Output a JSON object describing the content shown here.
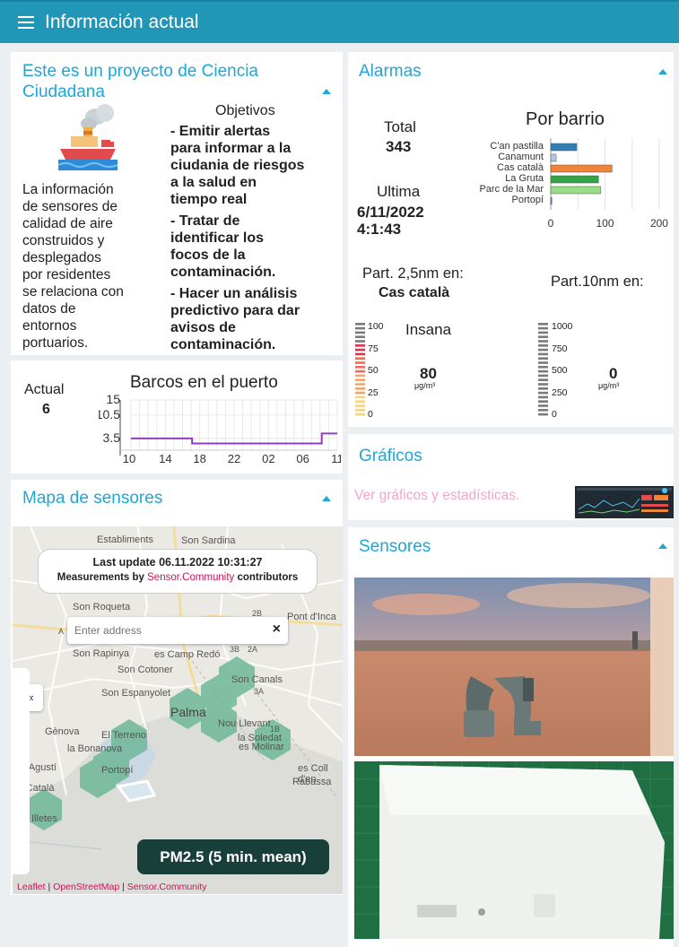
{
  "header": {
    "title": "Información actual",
    "menu_icon": "menu-icon"
  },
  "project": {
    "title": "Este es un proyecto de Ciencia Ciudadana",
    "logo_icon": "ship-smoke-icon",
    "description": [
      "La información",
      "de sensores de",
      "calidad de aire",
      "construidos y",
      "desplegados",
      "por residentes",
      "se relaciona con",
      "datos de",
      "entornos",
      "portuarios."
    ],
    "objectives_title": "Objetivos",
    "objectives": [
      [
        "- Emitir alertas",
        "para informar a la",
        "ciudania de riesgos",
        "a la salud en",
        "tiempo real"
      ],
      [
        "- Tratar de",
        "identificar los",
        "focos de la",
        "contaminación."
      ],
      [
        "- Hacer un análisis",
        "predictivo para dar",
        "avisos de",
        "contaminación."
      ]
    ]
  },
  "ships": {
    "current_label": "Actual",
    "current_value": "6",
    "chart_title": "Barcos en el puerto"
  },
  "map_card": {
    "title": "Mapa de sensores",
    "last_update": "Last update 06.11.2022 10:31:27",
    "measurements_prefix": "Measurements by ",
    "measurements_link": "Sensor.Community",
    "measurements_suffix": " contributors",
    "search_placeholder": "Enter address",
    "clear_label": "×",
    "sidebar_toggle": "«",
    "pm_badge": "PM2.5 (5 min. mean)",
    "attr_leaflet": "Leaflet",
    "attr_sep1": " | ",
    "attr_osm": "OpenStreetMap",
    "attr_sep2": " | ",
    "attr_sc": "Sensor.Community",
    "places": [
      "Establiments",
      "Son Sardina",
      "Son Roqueta",
      "Pont d'Inca",
      "Son Rapinya",
      "es Camp Redó",
      "Son Cotoner",
      "Son Canals",
      "Son Espanyolet",
      "Palma",
      "Nou Llevant",
      "Gènova",
      "El Terreno",
      "la Soledat",
      "la Bonanova",
      "es Molinar",
      "ant Agustí",
      "Portopí",
      "es Coll d'en",
      "Rabassa",
      "es Català",
      "Illetes",
      "3B",
      "2B",
      "2A",
      "3A",
      "1B",
      "A"
    ]
  },
  "alarms": {
    "title": "Alarmas",
    "total_label": "Total",
    "total_value": "343",
    "last_label": "Ultima",
    "last_date": "6/11/2022",
    "last_time": "4:1:43",
    "by_barrio_title": "Por barrio",
    "pm25_label": "Part. 2,5nm en:",
    "pm25_place": "Cas català",
    "pm10_label": "Part.10nm en:",
    "gauge1_status": "Insana",
    "gauge1_value": "80",
    "gauge1_unit": "μg/m³",
    "gauge1_ticks": [
      "100",
      "75",
      "50",
      "25",
      "0"
    ],
    "gauge2_value": "0",
    "gauge2_unit": "μg/m³",
    "gauge2_ticks": [
      "1000",
      "750",
      "500",
      "250",
      "0"
    ]
  },
  "graphs": {
    "title": "Gráficos",
    "link": "Ver gráficos y estadísticas."
  },
  "sensors": {
    "title": "Sensores"
  },
  "chart_data": [
    {
      "type": "bar",
      "title": "Por barrio",
      "orientation": "horizontal",
      "categories": [
        "C'an pastilla",
        "Canamunt",
        "Cas català",
        "La Gruta",
        "Parc de la Mar",
        "Portopí"
      ],
      "values": [
        48,
        10,
        113,
        88,
        92,
        2
      ],
      "colors": [
        "#2f7fb5",
        "#aec7e8",
        "#f0853a",
        "#35a447",
        "#98df8a",
        "#9467bd"
      ],
      "xlim": [
        0,
        205
      ],
      "xticks": [
        "0",
        "100",
        "200"
      ],
      "grid": true
    },
    {
      "type": "line",
      "title": "Barcos en el puerto",
      "x_ticks": [
        "10",
        "14",
        "18",
        "22",
        "02",
        "06",
        "11"
      ],
      "y_ticks": [
        "15",
        "10.5",
        "3.5"
      ],
      "series": [
        {
          "color": "#8e3fbf",
          "x": [
            10,
            17.5,
            17.5,
            33.4,
            33.4,
            35.3
          ],
          "y": [
            3.5,
            3.5,
            2,
            2,
            5,
            5
          ]
        }
      ],
      "xlim": [
        10,
        35.3
      ],
      "ylim": [
        0,
        15
      ],
      "grid": true
    }
  ]
}
